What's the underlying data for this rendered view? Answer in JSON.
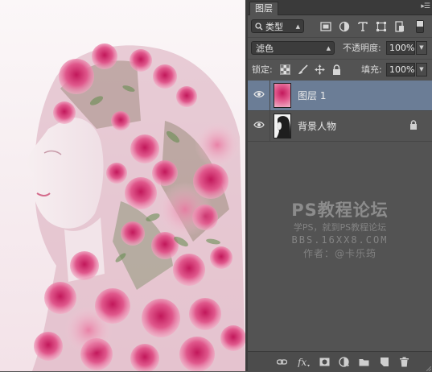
{
  "panel": {
    "tab_label": "图层",
    "menu_icon": "panel-menu-icon",
    "filter": {
      "kind_label": "类型",
      "icons": [
        "search-icon",
        "pixel-filter-icon",
        "adjustment-filter-icon",
        "type-filter-icon",
        "shape-filter-icon",
        "smart-object-filter-icon"
      ]
    },
    "blend": {
      "mode": "滤色",
      "opacity_label": "不透明度:",
      "opacity": "100%"
    },
    "lock": {
      "label": "锁定:",
      "fill_label": "填充:",
      "fill": "100%",
      "icons": [
        "lock-transparent-icon",
        "lock-paint-icon",
        "lock-move-icon",
        "lock-all-icon"
      ]
    },
    "layers": [
      {
        "name": "图层 1",
        "selected": true,
        "visible": true,
        "locked": false
      },
      {
        "name": "背景人物",
        "selected": false,
        "visible": true,
        "locked": true
      }
    ],
    "watermark": {
      "title": "PS教程论坛",
      "subtitle": "学PS，就到PS教程论坛",
      "url": "BBS.16XX8.COM",
      "author": "作者：@卡乐筠"
    },
    "bottom_icons": [
      "link-layers-icon",
      "fx-icon",
      "layer-mask-icon",
      "adjustment-layer-icon",
      "folder-icon",
      "new-layer-icon",
      "trash-icon"
    ]
  },
  "colors": {
    "selected_row": "#6b7d96",
    "panel_bg": "#535353",
    "field_bg": "#3c3c3c"
  }
}
